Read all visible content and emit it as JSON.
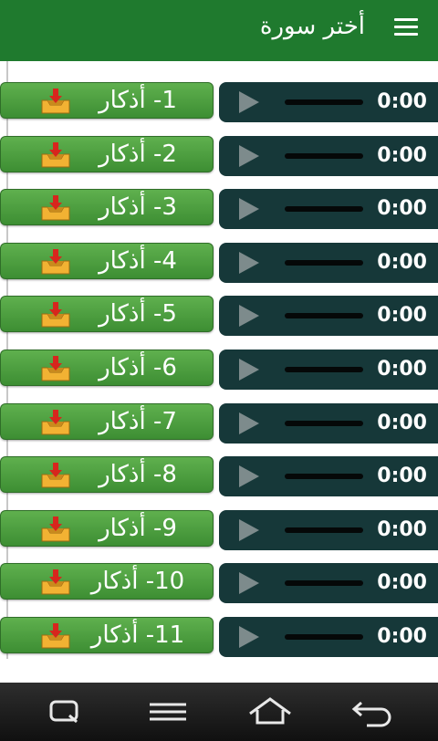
{
  "app_bar": {
    "title": "أختر سورة",
    "menu_icon": "hamburger-menu-icon"
  },
  "colors": {
    "app_bar_bg": "#1f7a2e",
    "label_button_bg": "#4a9e3f",
    "player_bg": "#163839",
    "nav_bar_bg": "#1a1a1a"
  },
  "tracks": [
    {
      "label": "1- أذكار",
      "time": "0:00"
    },
    {
      "label": "2- أذكار",
      "time": "0:00"
    },
    {
      "label": "3- أذكار",
      "time": "0:00"
    },
    {
      "label": "4- أذكار",
      "time": "0:00"
    },
    {
      "label": "5- أذكار",
      "time": "0:00"
    },
    {
      "label": "6- أذكار",
      "time": "0:00"
    },
    {
      "label": "7- أذكار",
      "time": "0:00"
    },
    {
      "label": "8- أذكار",
      "time": "0:00"
    },
    {
      "label": "9- أذكار",
      "time": "0:00"
    },
    {
      "label": "10- أذكار",
      "time": "0:00"
    },
    {
      "label": "11- أذكار",
      "time": "0:00"
    }
  ],
  "track_icons": {
    "download": "download-tray-icon",
    "play": "play-icon"
  },
  "nav_bar": {
    "buttons": [
      "search-icon",
      "menu-icon",
      "home-icon",
      "back-icon"
    ]
  }
}
